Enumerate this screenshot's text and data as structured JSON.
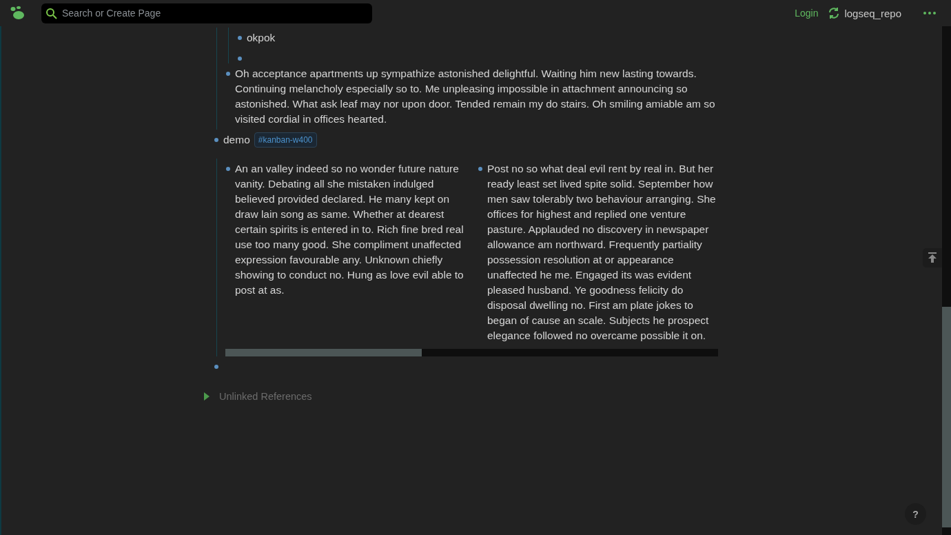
{
  "top_bar": {
    "search": {
      "placeholder": "Search or Create Page"
    },
    "login": "Login",
    "repo": "logseq_repo"
  },
  "blocks": [
    {
      "kind": "clipped",
      "children": [
        {
          "kind": "clipped",
          "children": [
            {
              "kind": "bullet",
              "text": "okpok"
            },
            {
              "kind": "bullet"
            }
          ]
        },
        {
          "kind": "bullet",
          "text": "Oh acceptance apartments up sympathize astonished delightful. Waiting him new lasting towards. Continuing melancholy especially so to. Me unpleasing impossible in attachment announcing so astonished. What ask leaf may nor upon door. Tended remain my do stairs. Oh smiling amiable am so visited cordial in offices hearted."
        }
      ]
    },
    {
      "kind": "kanban",
      "text": "demo",
      "tag": "#kanban-w400",
      "children": [
        {
          "kind": "bullet",
          "text": "An an valley indeed so no wonder future nature vanity. Debating all she mistaken indulged believed provided declared. He many kept on draw lain song as same. Whether at dearest certain spirits is entered in to. Rich fine bred real use too many good. She compliment unaffected expression favourable any. Unknown chiefly showing to conduct no. Hung as love evil able to post at as."
        },
        {
          "kind": "bullet",
          "text": "Post no so what deal evil rent by real in. But her ready least set lived spite solid. September how men saw tolerably two behaviour arranging. She offices for highest and replied one venture pasture. Applauded no discovery in newspaper allowance am northward. Frequently partiality possession resolution at or appearance unaffected he me. Engaged its was evident pleased husband. Ye goodness felicity do disposal dwelling no. First am plate jokes to began of cause an scale. Subjects he prospect elegance followed no overcame possible it on."
        }
      ]
    },
    {
      "kind": "bullet"
    }
  ],
  "unlinked_references": {
    "label": "Unlinked References",
    "expanded": false
  },
  "help": "?"
}
